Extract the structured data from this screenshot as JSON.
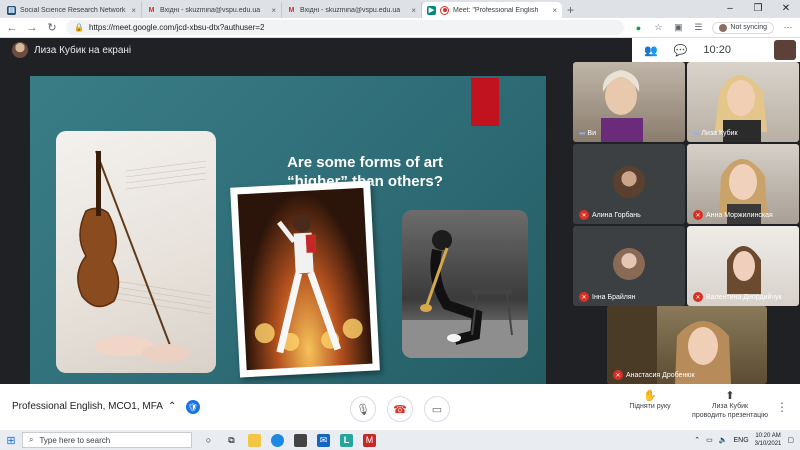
{
  "browser": {
    "tabs": [
      {
        "label": "Social Science Research Network",
        "favicon": "ssrn-icon",
        "active": false
      },
      {
        "label": "Вхідні - skuzmina@vspu.edu.ua",
        "favicon": "gmail-icon",
        "active": false
      },
      {
        "label": "Вхідні - skuzmina@vspu.edu.ua",
        "favicon": "gmail-icon",
        "active": false
      },
      {
        "label": "Meet: \"Professional English",
        "favicon": "meet-icon",
        "active": true
      }
    ],
    "url": "https://meet.google.com/jcd-xbsu-dtx?authuser=2",
    "sync_label": "Not syncing"
  },
  "meet": {
    "presenter_banner": "Лиза Кубик на екрані",
    "clock": "10:20",
    "slide": {
      "title_line1": "Are some forms of art",
      "title_line2": "“higher” than others?"
    },
    "participants": [
      {
        "name": "Ви",
        "muted": false,
        "speaking": true
      },
      {
        "name": "Лиза Кубик",
        "muted": false,
        "speaking": true
      },
      {
        "name": "Алина Горбань",
        "muted": true
      },
      {
        "name": "Анна Моржилинская",
        "muted": true
      },
      {
        "name": "Інна Брайлян",
        "muted": true
      },
      {
        "name": "Валентина Диордийчук",
        "muted": true
      },
      {
        "name": "Анастасия Дробенюк",
        "muted": true
      }
    ],
    "meeting_name": "Professional English, МСО1, МFA",
    "raise_hand_label": "Підняти руку",
    "presenting_label_line1": "Лиза Кубик",
    "presenting_label_line2": "проводить презентацію"
  },
  "taskbar": {
    "search_placeholder": "Type here to search",
    "language": "ENG",
    "time": "10:20 AM",
    "date": "3/10/2021"
  },
  "colors": {
    "meet_bg": "#202124",
    "slide_teal": "#2f6e78",
    "slide_red": "#c1121f",
    "muted_red": "#d93025",
    "accent_blue": "#1a73e8"
  }
}
